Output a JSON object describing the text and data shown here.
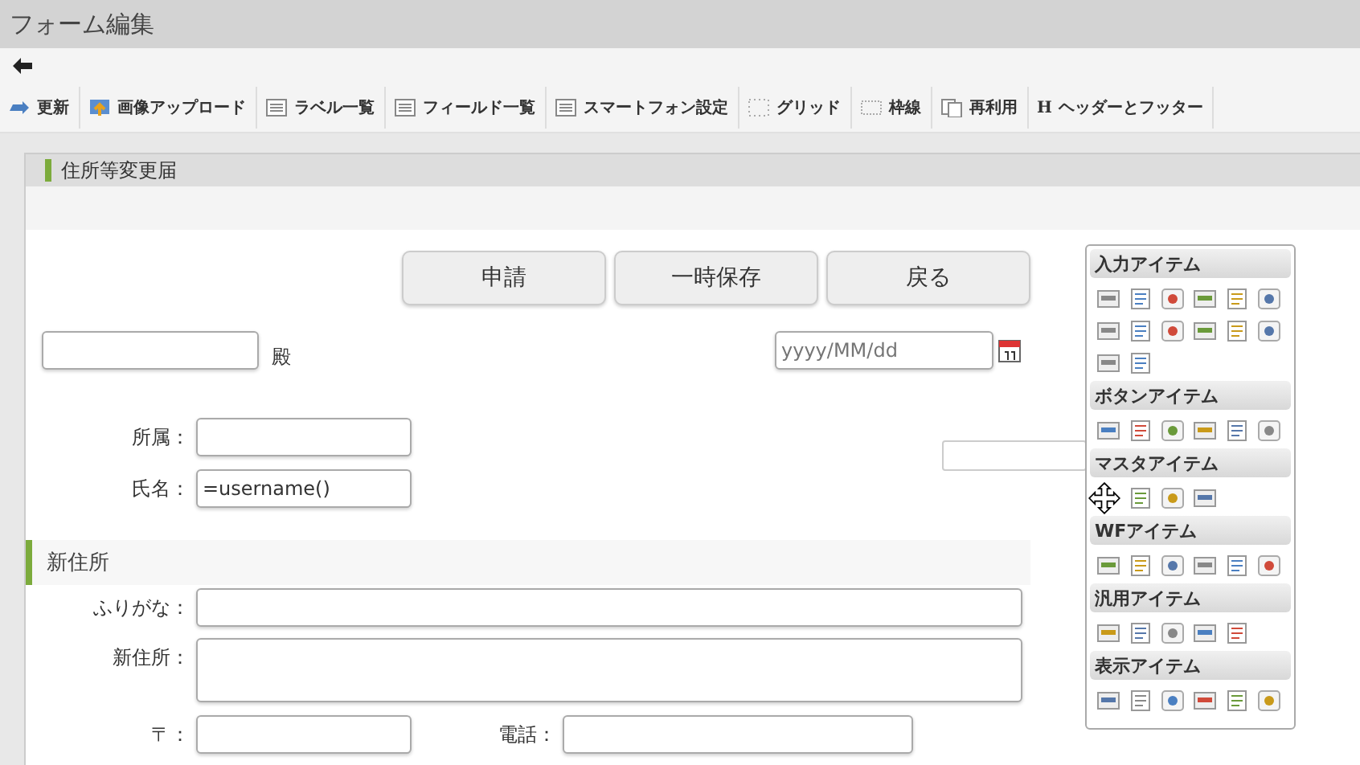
{
  "window": {
    "title": "フォーム編集"
  },
  "toolbar": [
    {
      "label": "更新"
    },
    {
      "label": "画像アップロード"
    },
    {
      "label": "ラベル一覧"
    },
    {
      "label": "フィールド一覧"
    },
    {
      "label": "スマートフォン設定"
    },
    {
      "label": "グリッド"
    },
    {
      "label": "枠線"
    },
    {
      "label": "再利用"
    },
    {
      "label": "ヘッダーとフッター",
      "glyph": "H"
    }
  ],
  "form": {
    "title": "住所等変更届",
    "buttons": [
      "申請",
      "一時保存",
      "戻る"
    ],
    "addressee_suffix": "殿",
    "date_placeholder": "yyyy/MM/dd",
    "fields": [
      {
        "label": "所属："
      },
      {
        "label": "氏名：",
        "value": "=username()"
      }
    ],
    "section": "新住所",
    "address_fields": [
      {
        "label": "ふりがな：",
        "kind": "line"
      },
      {
        "label": "新住所：",
        "kind": "area"
      }
    ],
    "postal_label": "〒：",
    "phone_label": "電話："
  },
  "palette": [
    {
      "title": "入力アイテム"
    },
    {
      "title": "ボタンアイテム"
    },
    {
      "title": "マスタアイテム"
    },
    {
      "title": "WFアイテム"
    },
    {
      "title": "汎用アイテム"
    },
    {
      "title": "表示アイテム"
    }
  ]
}
